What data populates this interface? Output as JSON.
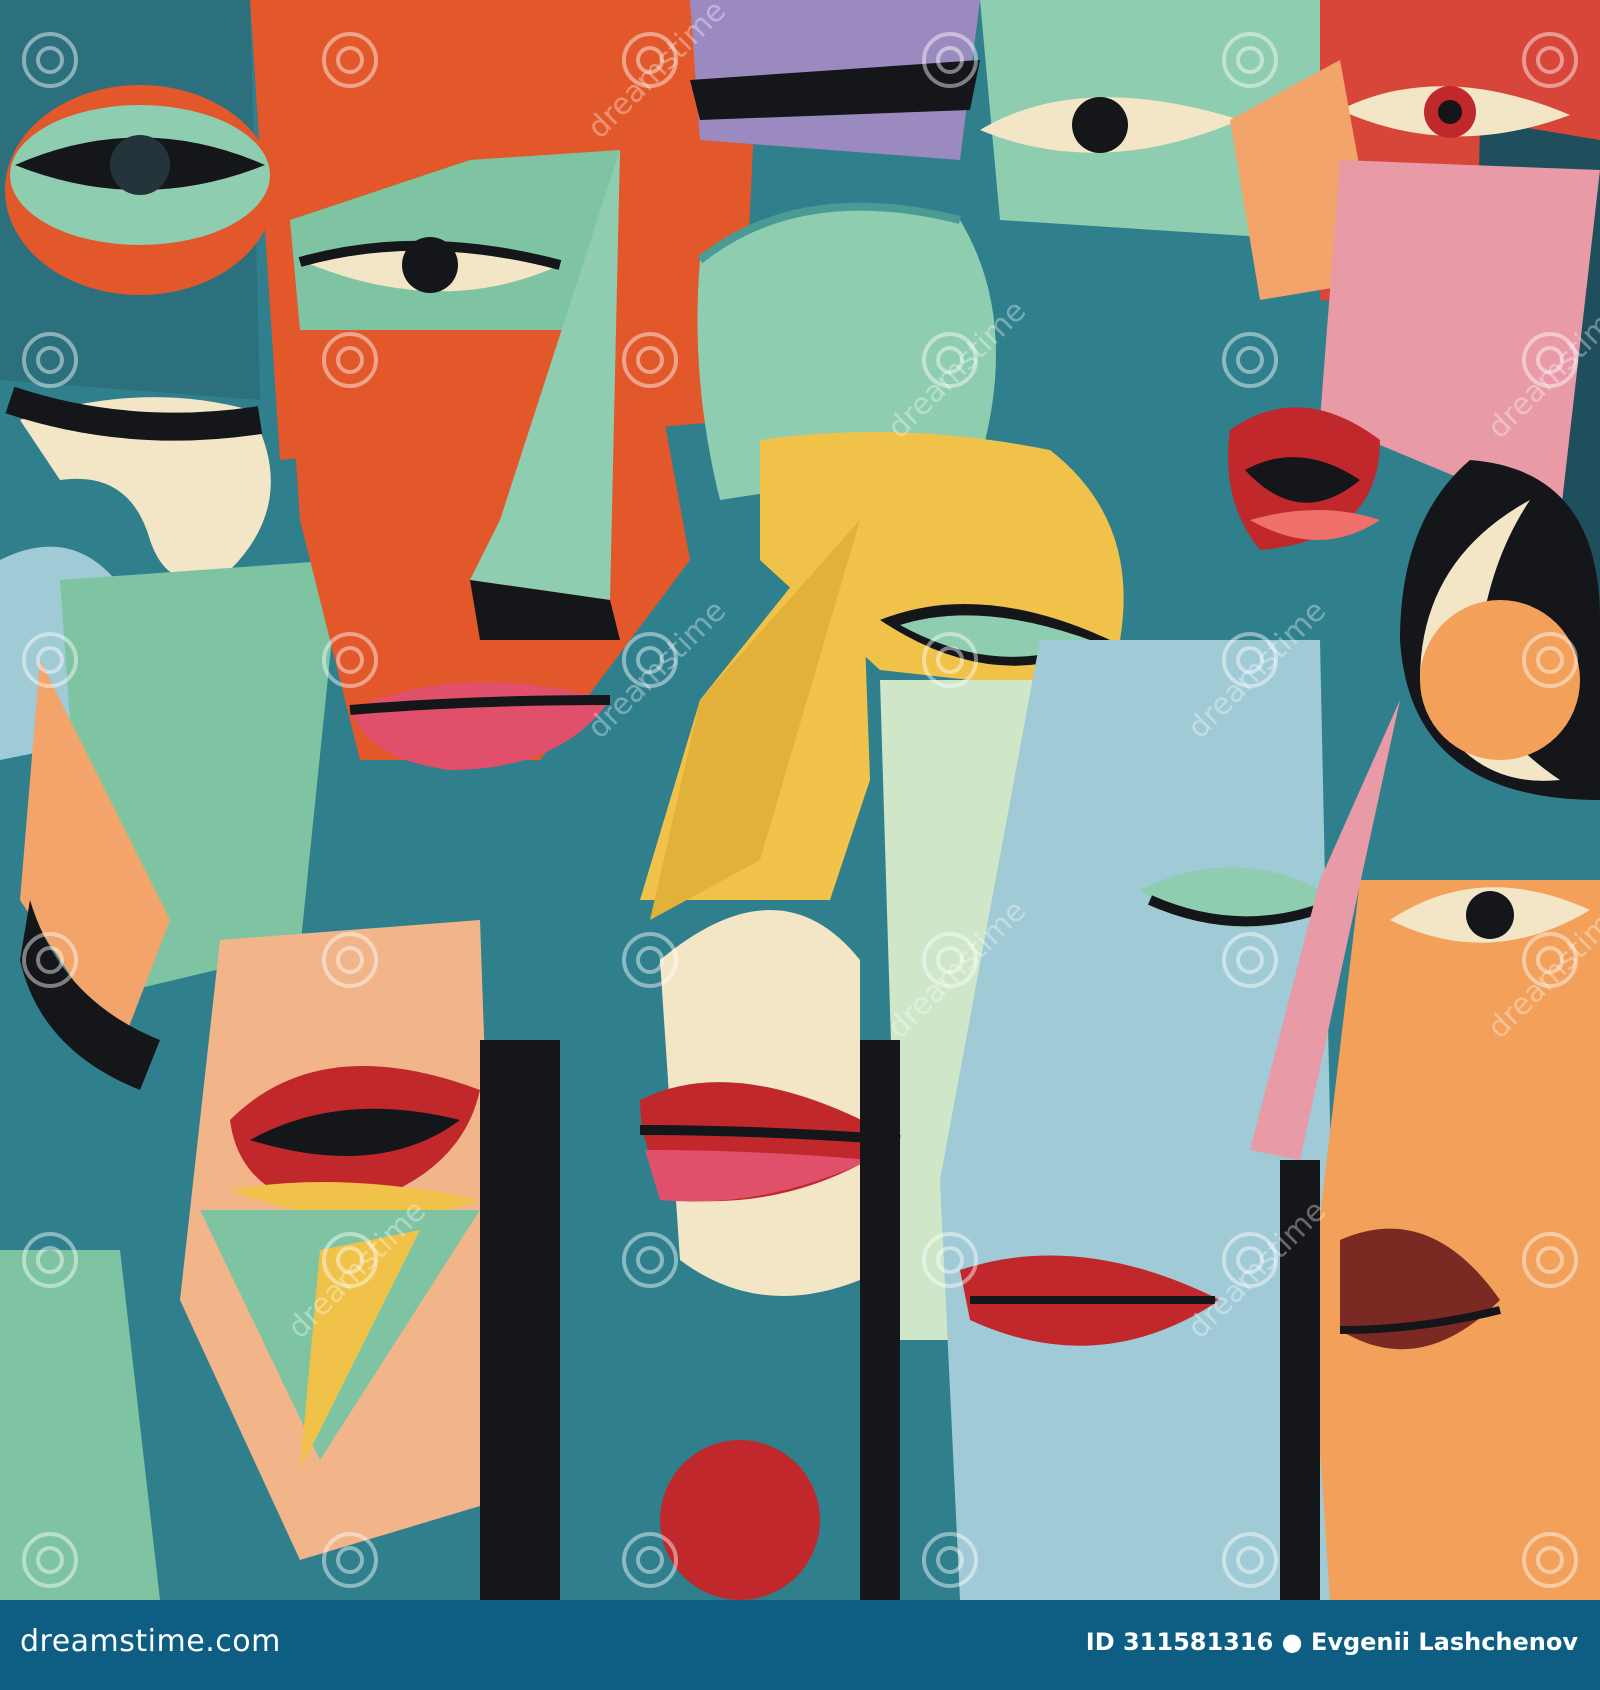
{
  "artwork": {
    "subject": "Cubist painting of multiple overlapping stylized faces",
    "palette": {
      "teal": "#2f7f8c",
      "mint": "#8fcdb0",
      "orange": "#e2582b",
      "yellow": "#f0c24a",
      "cream": "#f2e6c6",
      "pink": "#e89aa7",
      "red": "#c0282b",
      "black": "#14161a",
      "lightblue": "#9fcad6",
      "lavender": "#9b8ac0"
    }
  },
  "watermark": {
    "text": "dreamstime",
    "icon": "dreamstime-swirl-icon"
  },
  "footer": {
    "site": "dreamstime.com",
    "id_text": "ID 311581316",
    "author": "Evgenii Lashchenov",
    "background": "#0e5e84"
  }
}
